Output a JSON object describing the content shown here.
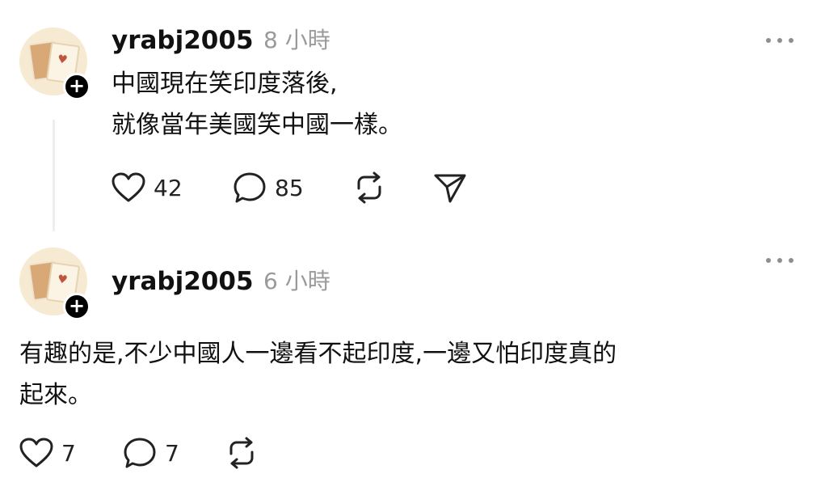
{
  "posts": [
    {
      "username": "yrabj2005",
      "time": "8 小時",
      "text_lines": [
        "中國現在笑印度落後,",
        "就像當年美國笑中國一樣。"
      ],
      "likes": "42",
      "comments": "85",
      "icons": [
        "heart-icon",
        "comment-icon",
        "repost-icon",
        "share-icon",
        "more-icon"
      ]
    },
    {
      "username": "yrabj2005",
      "time": "6 小時",
      "text_lines": [
        "有趣的是,不少中國人一邊看不起印度,一邊又怕印度真的",
        "起來。"
      ],
      "likes": "7",
      "comments": "7",
      "icons": [
        "heart-icon",
        "comment-icon",
        "repost-icon",
        "more-icon"
      ]
    }
  ],
  "follow_badge": "+",
  "colors": {
    "text": "#111111",
    "muted": "#9a9a9a",
    "avatar_bg": "#f6ead3",
    "badge": "#000000"
  }
}
